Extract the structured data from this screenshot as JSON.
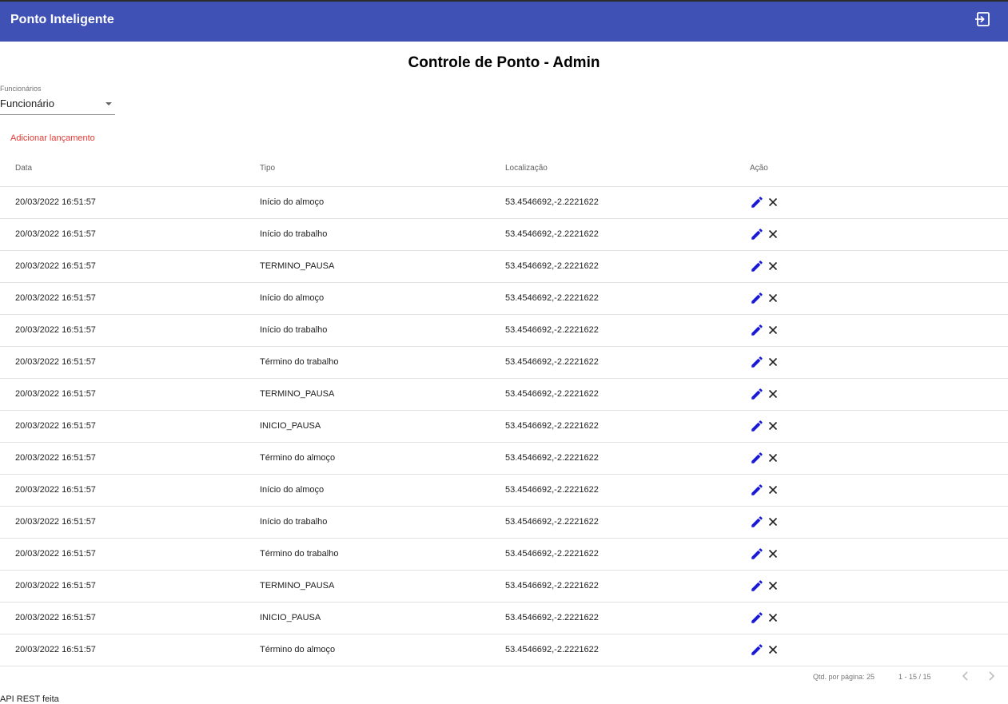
{
  "app": {
    "title": "Ponto Inteligente",
    "logout_icon": "logout-icon"
  },
  "page": {
    "title": "Controle de Ponto - Admin"
  },
  "employee_select": {
    "label": "Funcionários",
    "value": "Funcionário"
  },
  "actions": {
    "add_label": "Adicionar lançamento"
  },
  "table": {
    "headers": [
      "Data",
      "Tipo",
      "Localização",
      "Ação"
    ],
    "rows": [
      {
        "data": "20/03/2022 16:51:57",
        "tipo": "Início do almoço",
        "localizacao": "53.4546692,-2.2221622"
      },
      {
        "data": "20/03/2022 16:51:57",
        "tipo": "Início do trabalho",
        "localizacao": "53.4546692,-2.2221622"
      },
      {
        "data": "20/03/2022 16:51:57",
        "tipo": "TERMINO_PAUSA",
        "localizacao": "53.4546692,-2.2221622"
      },
      {
        "data": "20/03/2022 16:51:57",
        "tipo": "Início do almoço",
        "localizacao": "53.4546692,-2.2221622"
      },
      {
        "data": "20/03/2022 16:51:57",
        "tipo": "Início do trabalho",
        "localizacao": "53.4546692,-2.2221622"
      },
      {
        "data": "20/03/2022 16:51:57",
        "tipo": "Término do trabalho",
        "localizacao": "53.4546692,-2.2221622"
      },
      {
        "data": "20/03/2022 16:51:57",
        "tipo": "TERMINO_PAUSA",
        "localizacao": "53.4546692,-2.2221622"
      },
      {
        "data": "20/03/2022 16:51:57",
        "tipo": "INICIO_PAUSA",
        "localizacao": "53.4546692,-2.2221622"
      },
      {
        "data": "20/03/2022 16:51:57",
        "tipo": "Término do almoço",
        "localizacao": "53.4546692,-2.2221622"
      },
      {
        "data": "20/03/2022 16:51:57",
        "tipo": "Início do almoço",
        "localizacao": "53.4546692,-2.2221622"
      },
      {
        "data": "20/03/2022 16:51:57",
        "tipo": "Início do trabalho",
        "localizacao": "53.4546692,-2.2221622"
      },
      {
        "data": "20/03/2022 16:51:57",
        "tipo": "Término do trabalho",
        "localizacao": "53.4546692,-2.2221622"
      },
      {
        "data": "20/03/2022 16:51:57",
        "tipo": "TERMINO_PAUSA",
        "localizacao": "53.4546692,-2.2221622"
      },
      {
        "data": "20/03/2022 16:51:57",
        "tipo": "INICIO_PAUSA",
        "localizacao": "53.4546692,-2.2221622"
      },
      {
        "data": "20/03/2022 16:51:57",
        "tipo": "Término do almoço",
        "localizacao": "53.4546692,-2.2221622"
      }
    ],
    "row_icons": {
      "edit": "pencil-icon",
      "delete": "close-icon"
    }
  },
  "paginator": {
    "page_size_label": "Qtd. por página: 25",
    "range_label": "1 - 15 / 15"
  },
  "footer": {
    "text": "API REST feita"
  },
  "colors": {
    "primary": "#3f51b5",
    "accent": "#e53935",
    "edit_icon": "#1a1ad6"
  }
}
